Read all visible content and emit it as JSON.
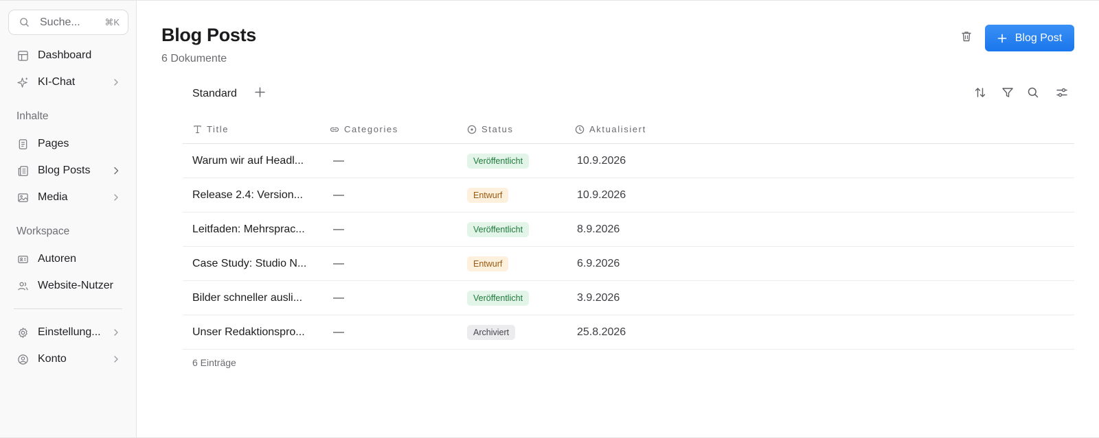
{
  "sidebar": {
    "search": {
      "placeholder": "Suche...",
      "shortcut": "⌘K"
    },
    "items": [
      {
        "label": "Dashboard",
        "icon": "dashboard-icon"
      },
      {
        "label": "KI-Chat",
        "icon": "sparkle-icon"
      }
    ],
    "sections": [
      {
        "title": "Inhalte",
        "items": [
          {
            "label": "Pages",
            "icon": "page-icon"
          },
          {
            "label": "Blog Posts",
            "icon": "blog-icon"
          },
          {
            "label": "Media",
            "icon": "image-icon"
          }
        ]
      },
      {
        "title": "Workspace",
        "items": [
          {
            "label": "Autoren",
            "icon": "id-card-icon"
          },
          {
            "label": "Website-Nutzer",
            "icon": "users-icon"
          }
        ]
      }
    ],
    "bottom": [
      {
        "label": "Einstellung...",
        "icon": "gear-icon"
      },
      {
        "label": "Konto",
        "icon": "user-circle-icon"
      }
    ]
  },
  "header": {
    "title": "Blog Posts",
    "subtitle": "6 Dokumente",
    "primary_button": "Blog Post"
  },
  "views": {
    "active": "Standard"
  },
  "table": {
    "columns": [
      "Title",
      "Categories",
      "Status",
      "Aktualisiert"
    ],
    "rows": [
      {
        "title": "Warum wir auf Headl...",
        "categories": "—",
        "status": "Veröffentlicht",
        "updated": "10.9.2026"
      },
      {
        "title": "Release 2.4: Version...",
        "categories": "—",
        "status": "Entwurf",
        "updated": "10.9.2026"
      },
      {
        "title": "Leitfaden: Mehrsprac...",
        "categories": "—",
        "status": "Veröffentlicht",
        "updated": "8.9.2026"
      },
      {
        "title": "Case Study: Studio N...",
        "categories": "—",
        "status": "Entwurf",
        "updated": "6.9.2026"
      },
      {
        "title": "Bilder schneller ausli...",
        "categories": "—",
        "status": "Veröffentlicht",
        "updated": "3.9.2026"
      },
      {
        "title": "Unser Redaktionspro...",
        "categories": "—",
        "status": "Archiviert",
        "updated": "25.8.2026"
      }
    ],
    "footer": "6 Einträge"
  },
  "colors": {
    "accent": "#1a76ec",
    "published_bg": "#e3f5e8",
    "published_fg": "#1f7a3c",
    "draft_bg": "#fdf0dc",
    "draft_fg": "#9a5a12",
    "archived_bg": "#ececef",
    "archived_fg": "#45454b"
  }
}
